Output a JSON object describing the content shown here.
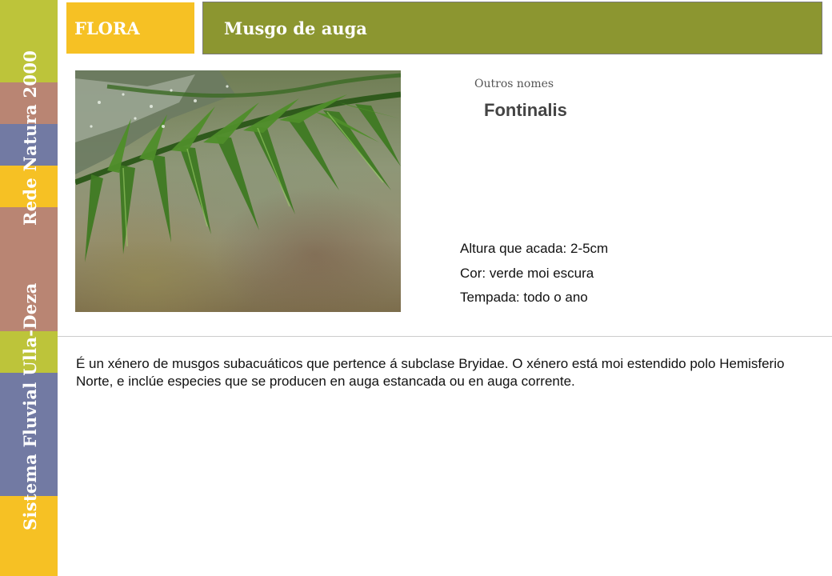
{
  "sidebar": {
    "colors": [
      "#bdc43a",
      "#b98573",
      "#727aa3",
      "#f6c124",
      "#b98573",
      "#bdc43a",
      "#727aa3",
      "#f6c124"
    ],
    "text_top": "Rede Natura 2000",
    "text_bottom": "Sistema Fluvial Ulla-Deza"
  },
  "header": {
    "section": "FLORA",
    "title": "Musgo de auga",
    "section_color": "#f6c124",
    "title_color": "#8c9630"
  },
  "species": {
    "other_names_label": "Outros nomes",
    "other_names": "Fontinalis",
    "facts": [
      "Altura que acada: 2-5cm",
      "Cor: verde moi escura",
      "Tempada: todo o ano"
    ],
    "description": "É un xénero de musgos subacuáticos que pertence á subclase Bryidae. O xénero está moi estendido polo Hemisferio Norte, e inclúe especies que se producen en auga estancada ou en auga corrente."
  }
}
